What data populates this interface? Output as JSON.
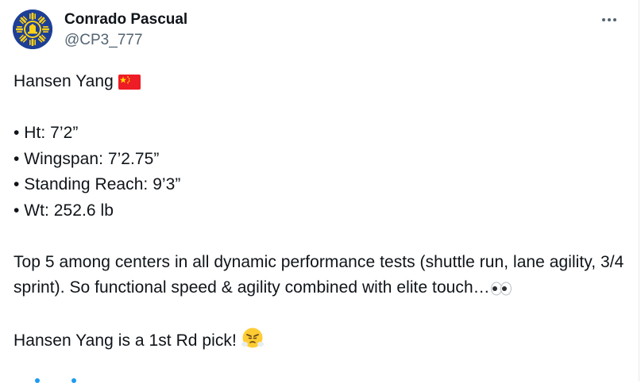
{
  "author": {
    "display_name": "Conrado Pascual",
    "handle": "@CP3_777",
    "avatar_icon": "sun-flag-avatar"
  },
  "more_icon": "more-horizontal-icon",
  "tweet": {
    "title": "Hansen Yang",
    "title_flag": "china-flag-icon",
    "bullets": [
      "• Ht: 7’2”",
      "• Wingspan: 7’2.75”",
      "• Standing Reach: 9’3”",
      "• Wt: 252.6 lb"
    ],
    "paragraph_1": "Top 5 among centers in all dynamic performance tests (shuttle run, lane agility, 3/4 sprint). So functional speed & agility combined with elite touch…",
    "paragraph_1_emoji": "eyes-emoji",
    "paragraph_2": "Hansen Yang is a 1st Rd pick!",
    "paragraph_2_emoji": "face-with-steam-emoji"
  },
  "colors": {
    "text": "#0f1419",
    "secondary": "#536471",
    "avatar_bg": "#1d3f96",
    "flag_red": "#ee1c25",
    "flag_star": "#ffde00"
  }
}
